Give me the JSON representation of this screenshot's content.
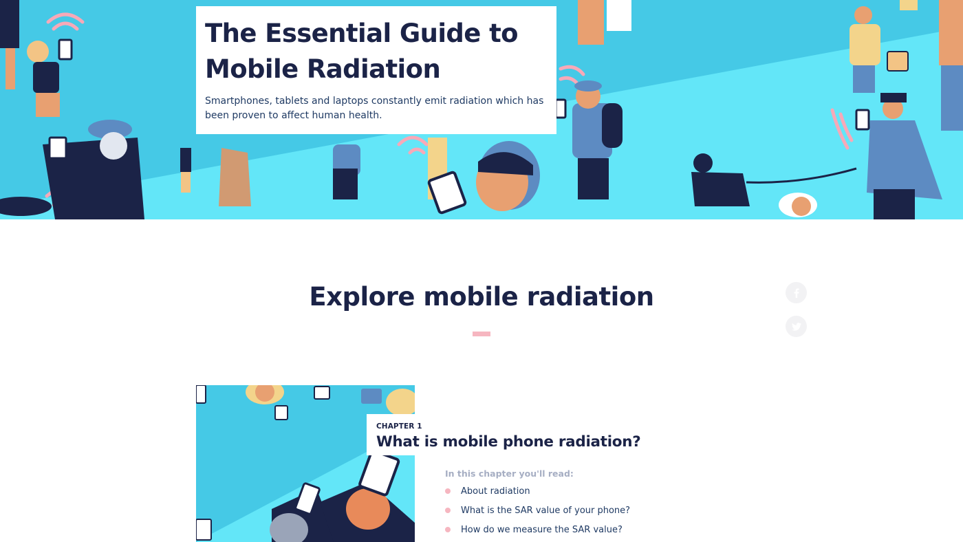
{
  "hero": {
    "title_line1": "The Essential Guide to",
    "title_line2": "Mobile Radiation",
    "subtitle_line1": "Smartphones, tablets and laptops constantly emit radiation which has",
    "subtitle_line2": "been proven to affect human health."
  },
  "explore": {
    "title": "Explore mobile radiation"
  },
  "social": {
    "facebook_icon": "facebook-icon",
    "twitter_icon": "twitter-icon"
  },
  "chapter": {
    "kicker": "CHAPTER 1",
    "title": "What is mobile phone radiation?",
    "toc_heading": "In this chapter you'll read:",
    "items": [
      {
        "label": "About radiation"
      },
      {
        "label": "What is the SAR value of your phone?"
      },
      {
        "label": "How do we measure the SAR value?"
      }
    ]
  },
  "colors": {
    "navy": "#1b2347",
    "sky": "#45c9e6",
    "sky_light": "#63e6f8",
    "pink": "#f6b6c0",
    "muted": "#a6aec3"
  }
}
